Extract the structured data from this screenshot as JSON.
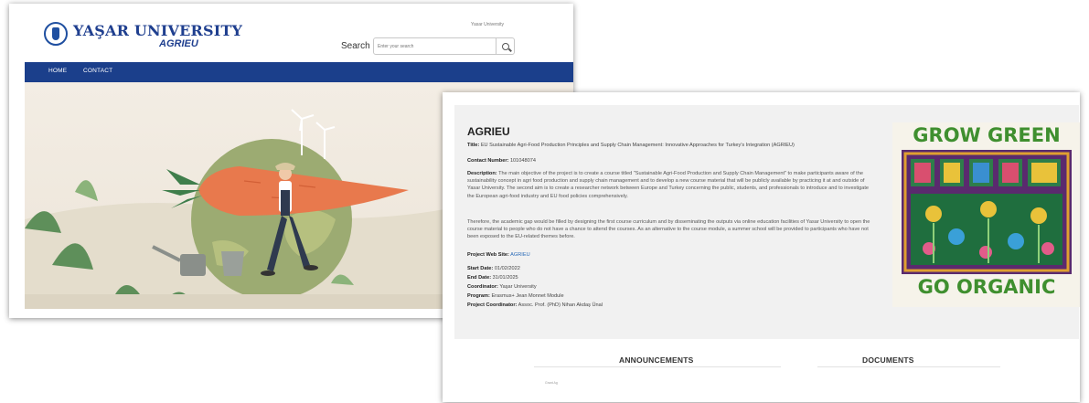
{
  "home_page": {
    "logo": {
      "title": "YAŞAR UNIVERSITY",
      "subtitle": "AGRIEU",
      "icon": "university-emblem-icon"
    },
    "top_link": "Yasar University",
    "search": {
      "label": "Search",
      "placeholder": "Enter your search"
    },
    "nav": {
      "items": [
        "HOME",
        "CONTACT"
      ]
    },
    "colors": {
      "nav_bg": "#1b3f8b",
      "brand": "#1f3f8f"
    }
  },
  "project_page": {
    "title": "AGRIEU",
    "fields": {
      "title_label": "Title:",
      "title_value": "EU Sustainable Agri-Food Production Principles and Supply Chain Management: Innovative Approaches for Turkey's Integration (AGRIEU)",
      "contract_label": "Contact Number:",
      "contract_value": "101048074",
      "description_label": "Description:",
      "description_value": "The main objective of the project is to create a course titled \"Sustainable Agri-Food Production and Supply Chain Management\" to make participants aware of the sustainability concept in agri food production and supply chain management and to develop a new course material that will be publicly available by practicing it at and outside of Yasar University. The second aim is to create a researcher network between Europe and Turkey concerning the public, students, and professionals to introduce and to investigate the European agri-food industry and EU food policies comprehensively.",
      "paragraph2": "Therefore, the academic gap would be filled by designing the first course curriculum and by disseminating the outputs via online education facilities of Yasar University to open the course material to people who do not have a chance to attend the courses. As an alternative to the course module, a summer school will be provided to participants who have not been exposed to the EU-related themes before.",
      "website_label": "Project Web Site:",
      "website_value": "AGRIEU",
      "start_label": "Start Date:",
      "start_value": "01/02/2022",
      "end_label": "End Date:",
      "end_value": "31/01/2025",
      "coordinator_label": "Coordinator:",
      "coordinator_value": "Yaşar University",
      "program_label": "Program:",
      "program_value": "Erasmus+ Jean Monnet Module",
      "project_coordinator_label": "Project Coordinator:",
      "project_coordinator_value": "Assoc. Prof. (PhD) Nihan Akdaş Ünal"
    },
    "poster": {
      "top_text": "GROW GREEN",
      "bottom_text": "GO ORGANIC",
      "icon": "leaf-icon"
    },
    "sections": {
      "announcements": "ANNOUNCEMENTS",
      "documents": "DOCUMENTS"
    },
    "tiny_text": "Grant Ag",
    "colors": {
      "poster_green": "#3f8f2f",
      "poster_purple": "#5a2a6e",
      "link": "#2a6bb8"
    }
  }
}
